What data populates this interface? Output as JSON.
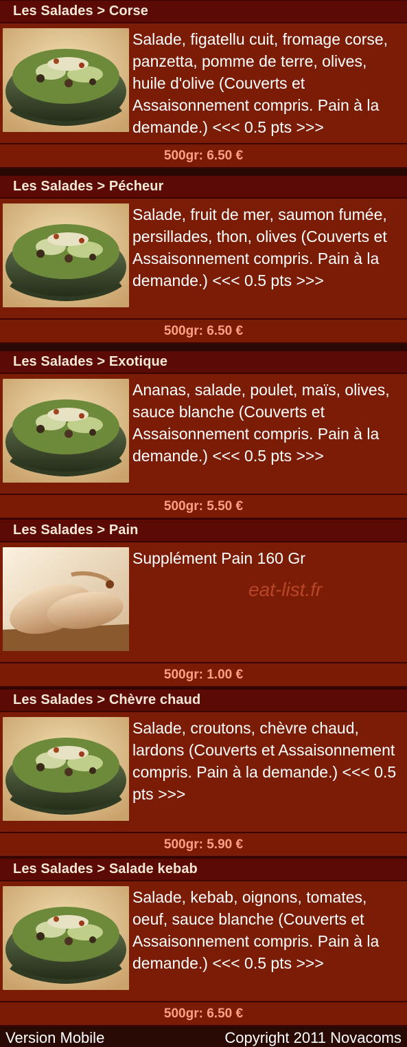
{
  "items": [
    {
      "header": "Les Salades > Corse",
      "description": "Salade, figatellu cuit, fromage corse, panzetta, pomme de terre, olives, huile d'olive (Couverts et Assaisonnement compris. Pain à la demande.) <<< 0.5 pts >>>",
      "price": "500gr: 6.50 €",
      "image": "salad-bowl"
    },
    {
      "header": "Les Salades > Pécheur",
      "description": "Salade, fruit de mer, saumon fumée, persillades, thon, olives (Couverts et Assaisonnement compris. Pain à la demande.) <<< 0.5 pts >>>",
      "price": "500gr: 6.50 €",
      "image": "salad-bowl"
    },
    {
      "header": "Les Salades > Exotique",
      "description": "Ananas, salade, poulet, maïs, olives, sauce blanche (Couverts et Assaisonnement compris. Pain à la demande.) <<< 0.5 pts >>>",
      "price": "500gr: 5.50 €",
      "image": "salad-bowl"
    },
    {
      "header": "Les Salades > Pain",
      "description": "Supplément Pain 160 Gr",
      "price": "500gr: 1.00 €",
      "image": "bread"
    },
    {
      "header": "Les Salades > Chèvre chaud",
      "description": "Salade, croutons, chèvre chaud, lardons (Couverts et Assaisonnement compris. Pain à la demande.) <<< 0.5 pts >>>",
      "price": "500gr: 5.90 €",
      "image": "salad-bowl"
    },
    {
      "header": "Les Salades > Salade kebab",
      "description": "Salade, kebab, oignons, tomates, oeuf, sauce blanche (Couverts et Assaisonnement compris. Pain à la demande.) <<< 0.5 pts >>>",
      "price": "500gr: 6.50 €",
      "image": "salad-bowl"
    }
  ],
  "watermark": "eat-list.fr",
  "footer": {
    "left": "Version Mobile",
    "right": "Copyright 2011 Novacoms"
  },
  "colors": {
    "header_bg": "#5b0a05",
    "body_bg": "#7b1c07",
    "price_text": "#ff9f84",
    "header_text": "#f6e8d6"
  }
}
